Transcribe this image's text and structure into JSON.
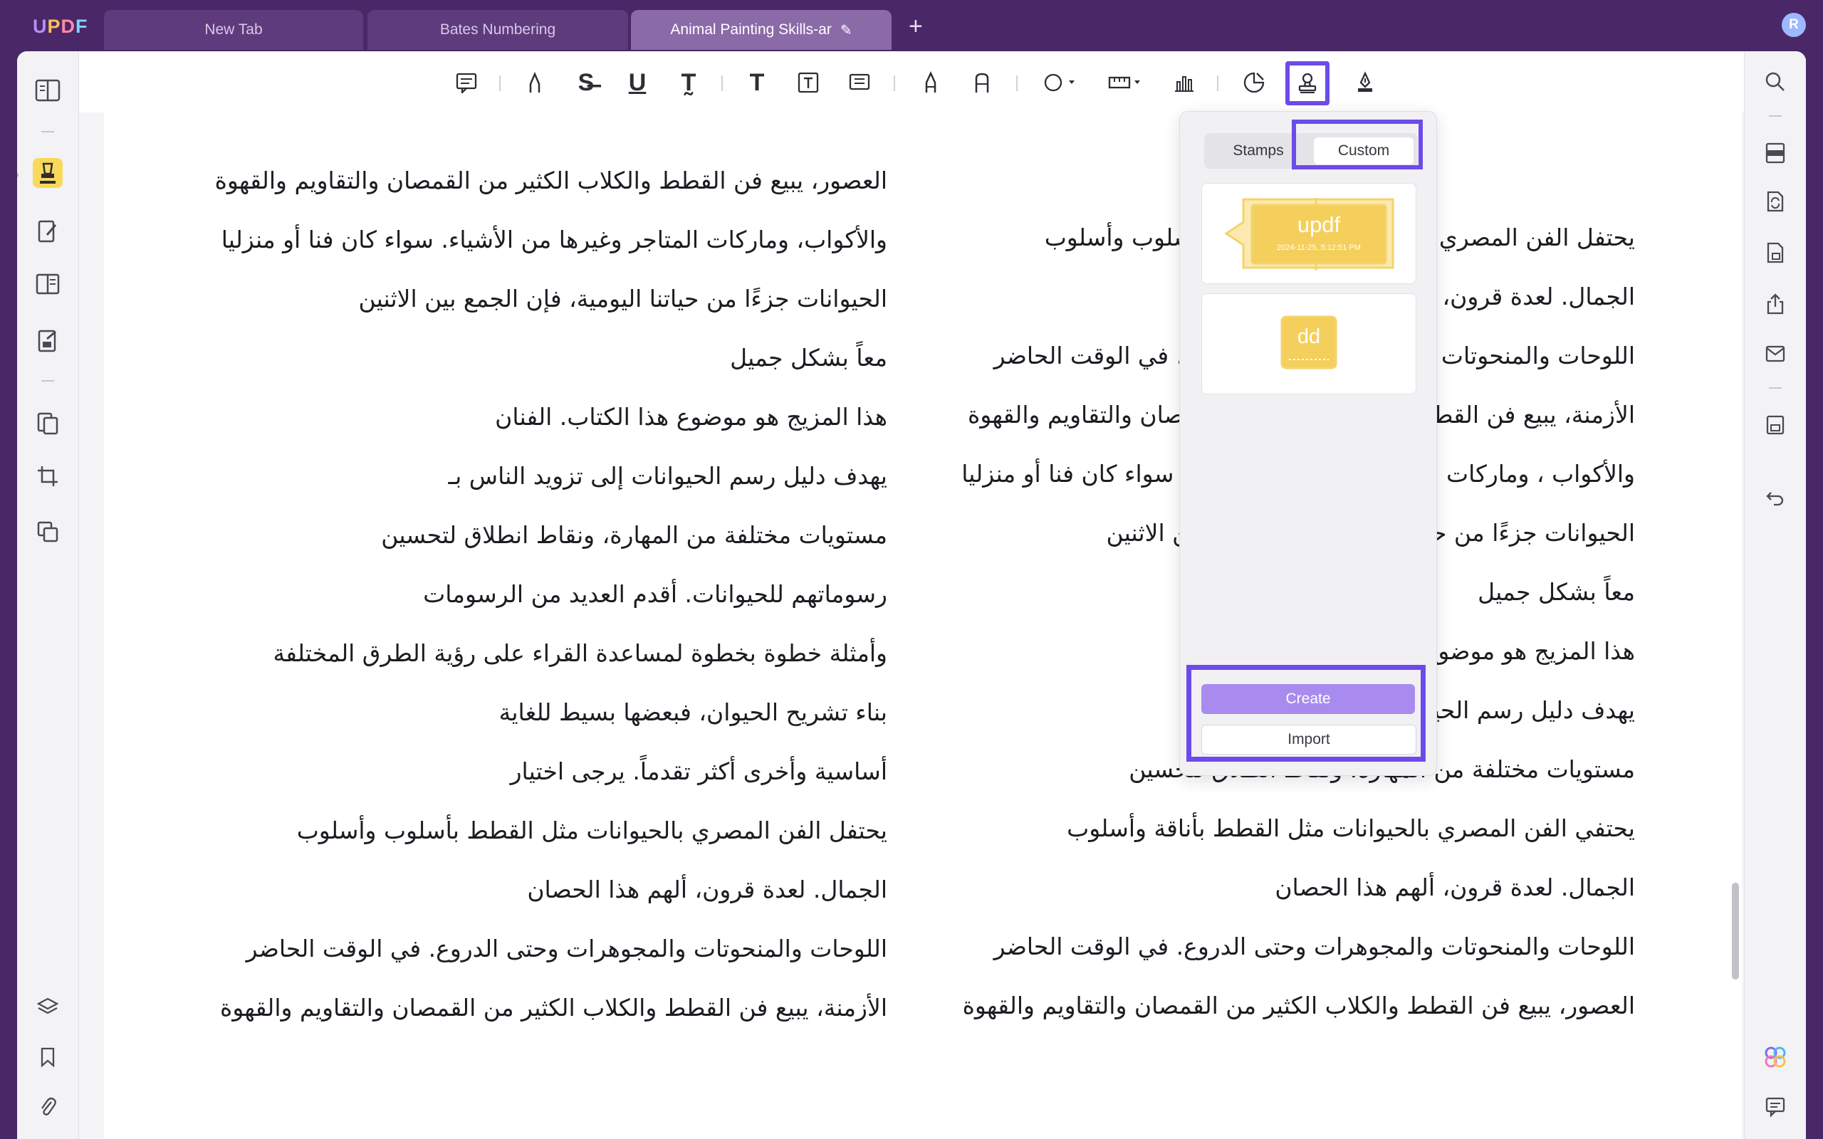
{
  "app": {
    "logo": "UPDF",
    "account_initial": "R"
  },
  "tabs": [
    {
      "label": "New Tab"
    },
    {
      "label": "Bates Numbering"
    },
    {
      "label": "Animal Painting Skills-ar"
    }
  ],
  "toolbar": {
    "icons": [
      "note-icon",
      "highlight-icon",
      "strikethrough-icon",
      "underline-icon",
      "squiggly-icon",
      "text-icon",
      "textbox-icon",
      "text-callout-icon",
      "pencil-icon",
      "eraser-icon",
      "shape-icon",
      "measure-icon",
      "chart-icon",
      "sticker-icon",
      "stamp-icon",
      "signature-icon"
    ],
    "selected": "stamp-icon"
  },
  "stamp_popup": {
    "tabs": [
      {
        "label": "Stamps"
      },
      {
        "label": "Custom"
      }
    ],
    "active_tab": "Custom",
    "stamps": [
      {
        "text": "updf",
        "subtext": "2024-11-25, 5:12:51 PM",
        "color": "#f5cf5c"
      },
      {
        "text": "dd",
        "color": "#f5cf5c"
      }
    ],
    "create_label": "Create",
    "import_label": "Import"
  },
  "document": {
    "left_column": [
      "العصور، يبيع فن القطط والكلاب الكثير من القمصان والتقاويم والقهوة",
      "والأكواب، وماركات المتاجر وغيرها من الأشياء. سواء كان فنا أو منزليا",
      "الحيوانات جزءًا من حياتنا اليومية، فإن الجمع بين الاثنين",
      "معاً بشكل جميل",
      "هذا المزيج هو موضوع هذا الكتاب. الفنان",
      "يهدف دليل رسم الحيوانات إلى تزويد الناس بـ",
      "مستويات مختلفة من المهارة، ونقاط انطلاق لتحسين",
      "رسوماتهم للحيوانات. أقدم العديد من الرسومات",
      "وأمثلة خطوة بخطوة لمساعدة القراء على رؤية الطرق المختلفة",
      "بناء تشريح الحيوان، فبعضها بسيط للغاية",
      "أساسية وأخرى أكثر تقدماً. يرجى اختيار",
      "يحتفل الفن المصري بالحيوانات مثل القطط بأسلوب وأسلوب",
      "الجمال. لعدة قرون، ألهم هذا الحصان",
      "اللوحات والمنحوتات والمجوهرات وحتى الدروع. في الوقت الحاضر",
      "الأزمنة، يبيع فن القطط والكلاب الكثير من القمصان والتقاويم والقهوة"
    ],
    "right_column": [
      "يحتفل الفن المصري بالحيوانات مثل القطط بأسلوب وأسلوب",
      "الجمال. لعدة قرون، ألهم هذا الحصان",
      "اللوحات والمنحوتات والمجوهرات وحتى الدروع. في الوقت الحاضر",
      "الأزمنة، يبيع فن القطط والكلاب الكثير من القمصان والتقاويم والقهوة",
      "والأكواب ، وماركات المتاجر وغيرها من الأشياء. سواء كان فنا أو منزليا",
      "الحيوانات جزءًا من حياتنا اليومية، فإن الجمع بين الاثنين",
      "معاً بشكل جميل",
      "هذا المزيج هو موضوع هذا الكتاب. الفنان",
      "يهدف دليل رسم الحيوانات إلى تزويد الناس بـ",
      "مستويات مختلفة من المهارة، ونقاط انطلاق لتحسين",
      "يحتفي الفن المصري بالحيوانات مثل القطط بأناقة وأسلوب",
      "الجمال. لعدة قرون، ألهم هذا الحصان",
      "اللوحات والمنحوتات والمجوهرات وحتى الدروع. في الوقت الحاضر",
      "العصور، يبيع فن القطط والكلاب الكثير من القمصان والتقاويم والقهوة"
    ]
  },
  "colors": {
    "accent": "#6c4bea",
    "titlebar": "#4a2766",
    "highlight_active": "#f9d95a",
    "create_button": "#a98bef"
  }
}
